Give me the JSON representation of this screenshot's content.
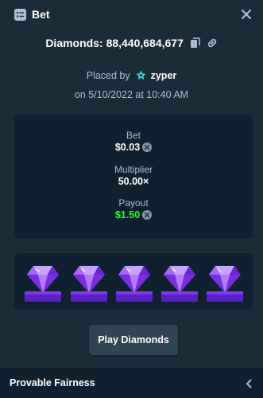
{
  "header": {
    "title": "Bet"
  },
  "game": {
    "name": "Diamonds",
    "separator": ":",
    "bet_id": "88,440,684,677"
  },
  "placed": {
    "prefix": "Placed by",
    "username": "zyper",
    "date_line": "on 5/10/2022 at 10:40 AM"
  },
  "stats": {
    "bet_label": "Bet",
    "bet_value": "$0.03",
    "multiplier_label": "Multiplier",
    "multiplier_value": "50.00×",
    "payout_label": "Payout",
    "payout_value": "$1.50"
  },
  "result": {
    "gems": [
      "purple-diamond",
      "purple-diamond",
      "purple-diamond",
      "purple-diamond",
      "purple-diamond"
    ]
  },
  "actions": {
    "play_label": "Play Diamonds"
  },
  "footer": {
    "label": "Provable Fairness"
  },
  "colors": {
    "background": "#1a2c38",
    "card": "#0f212e",
    "muted_text": "#b1bad3",
    "payout_green": "#1fff20",
    "gem_purple": "#8c3cf0",
    "button": "#2f4553"
  }
}
